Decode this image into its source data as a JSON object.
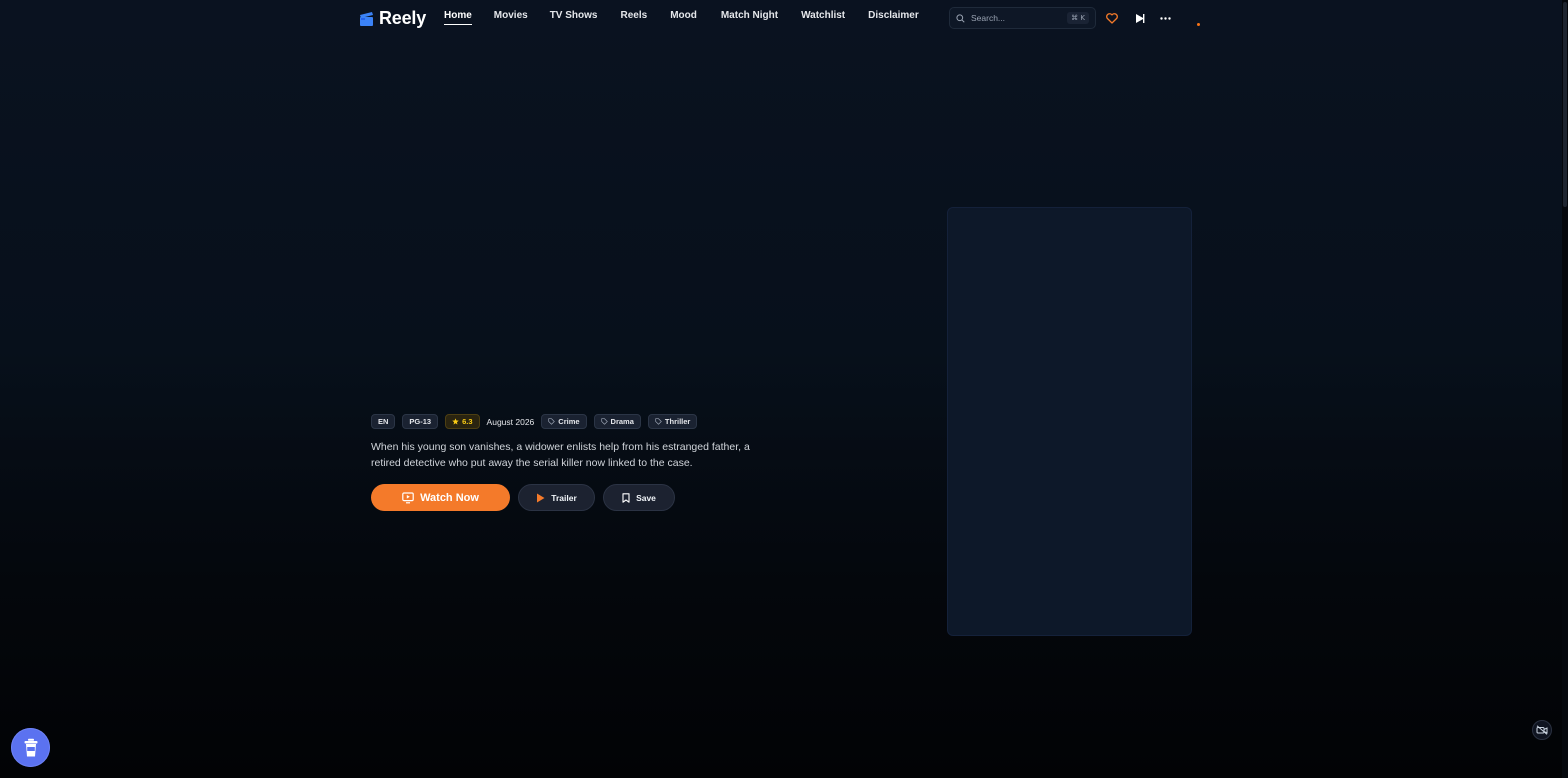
{
  "app": {
    "name": "Reely"
  },
  "nav": {
    "items": [
      {
        "label": "Home",
        "active": true
      },
      {
        "label": "Movies",
        "active": false
      },
      {
        "label": "TV Shows",
        "active": false
      },
      {
        "label": "Reels",
        "active": false
      },
      {
        "label": "Mood",
        "active": false
      },
      {
        "label": "Match Night",
        "active": false
      },
      {
        "label": "Watchlist",
        "active": false
      },
      {
        "label": "Disclaimer",
        "active": false
      }
    ]
  },
  "search": {
    "placeholder": "Search...",
    "shortcut": "⌘ K",
    "icon": "search-icon"
  },
  "header_icons": [
    "heart-icon",
    "play-icon",
    "more-icon"
  ],
  "hero": {
    "language": "EN",
    "certification": "PG-13",
    "rating": "6.3",
    "release": "August 2026",
    "genres": [
      "Crime",
      "Drama",
      "Thriller"
    ],
    "description": "When his young son vanishes, a widower enlists help from his estranged father, a retired detective who put away the serial killer now linked to the case.",
    "actions": {
      "watch_now": "Watch Now",
      "trailer": "Trailer",
      "save": "Save"
    }
  },
  "colors": {
    "accent": "#f47a2a",
    "rating": "#facc15",
    "fab": "#5b72f0",
    "logo": "#3b82f6"
  },
  "widgets": {
    "fab_icon": "cup-icon",
    "camera_icon": "camera-off-icon"
  }
}
